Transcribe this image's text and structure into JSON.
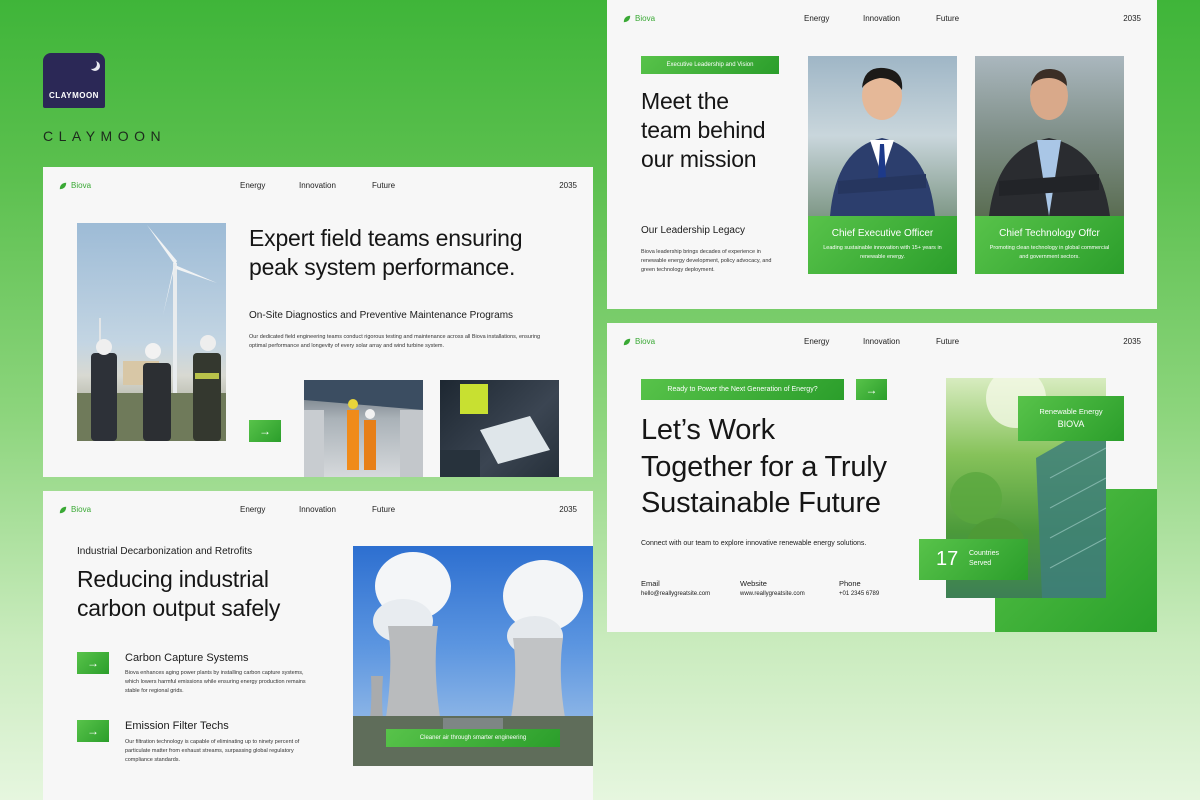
{
  "logo": {
    "badge_text": "CLAYMOON",
    "wordmark": "CLAYMOON"
  },
  "nav": {
    "brand": "Biova",
    "items": [
      "Energy",
      "Innovation",
      "Future"
    ],
    "year": "2035"
  },
  "slide_field": {
    "title_line1": "Expert field teams ensuring",
    "title_line2": "peak system performance.",
    "subtitle": "On-Site Diagnostics and Preventive Maintenance Programs",
    "body": "Our dedicated field engineering teams conduct rigorous testing and maintenance across all Biova installations, ensuring optimal performance and longevity of every solar array and wind turbine system.",
    "arrow": "→"
  },
  "slide_industrial": {
    "eyebrow": "Industrial Decarbonization and Retrofits",
    "title_line1": "Reducing industrial",
    "title_line2": "carbon output safely",
    "features": [
      {
        "title": "Carbon Capture Systems",
        "body": "Biova enhances aging power plants by installing carbon capture systems, which lowers harmful emissions while ensuring energy production remains stable for regional grids.",
        "arrow": "→"
      },
      {
        "title": "Emission Filter Techs",
        "body": "Our filtration technology is capable of eliminating up to ninety percent of particulate matter from exhaust streams, surpassing global regulatory compliance standards.",
        "arrow": "→"
      }
    ],
    "caption": "Cleaner air through smarter engineering"
  },
  "slide_team": {
    "tag": "Executive Leadership and Vision",
    "title_line1": "Meet the",
    "title_line2": "team behind",
    "title_line3": "our mission",
    "legacy_title": "Our Leadership Legacy",
    "legacy_body": "Biova leadership brings decades of experience in renewable energy development, policy advocacy, and green technology deployment.",
    "members": [
      {
        "role": "Chief Executive Officer",
        "desc": "Leading sustainable innovation with 15+ years in renewable energy."
      },
      {
        "role": "Chief Technology Offcr",
        "desc": "Promoting clean technology in global commercial and government sectors."
      }
    ]
  },
  "slide_contact": {
    "pill": "Ready to Power the Next Generation of Energy?",
    "pill_arrow": "→",
    "title_line1": "Let’s Work",
    "title_line2": "Together for a Truly",
    "title_line3": "Sustainable Future",
    "intro": "Connect with our team to explore innovative renewable energy solutions.",
    "contacts": [
      {
        "label": "Email",
        "value": "hello@reallygreatsite.com"
      },
      {
        "label": "Website",
        "value": "www.reallygreatsite.com"
      },
      {
        "label": "Phone",
        "value": "+01 2345 6789"
      }
    ],
    "badge_line1": "Renewable Energy",
    "badge_line2": "BIOVA",
    "stat_number": "17",
    "stat_label_line1": "Countries",
    "stat_label_line2": "Served"
  },
  "colors": {
    "accent": "#3aa935",
    "dark_badge": "#2b2856"
  }
}
